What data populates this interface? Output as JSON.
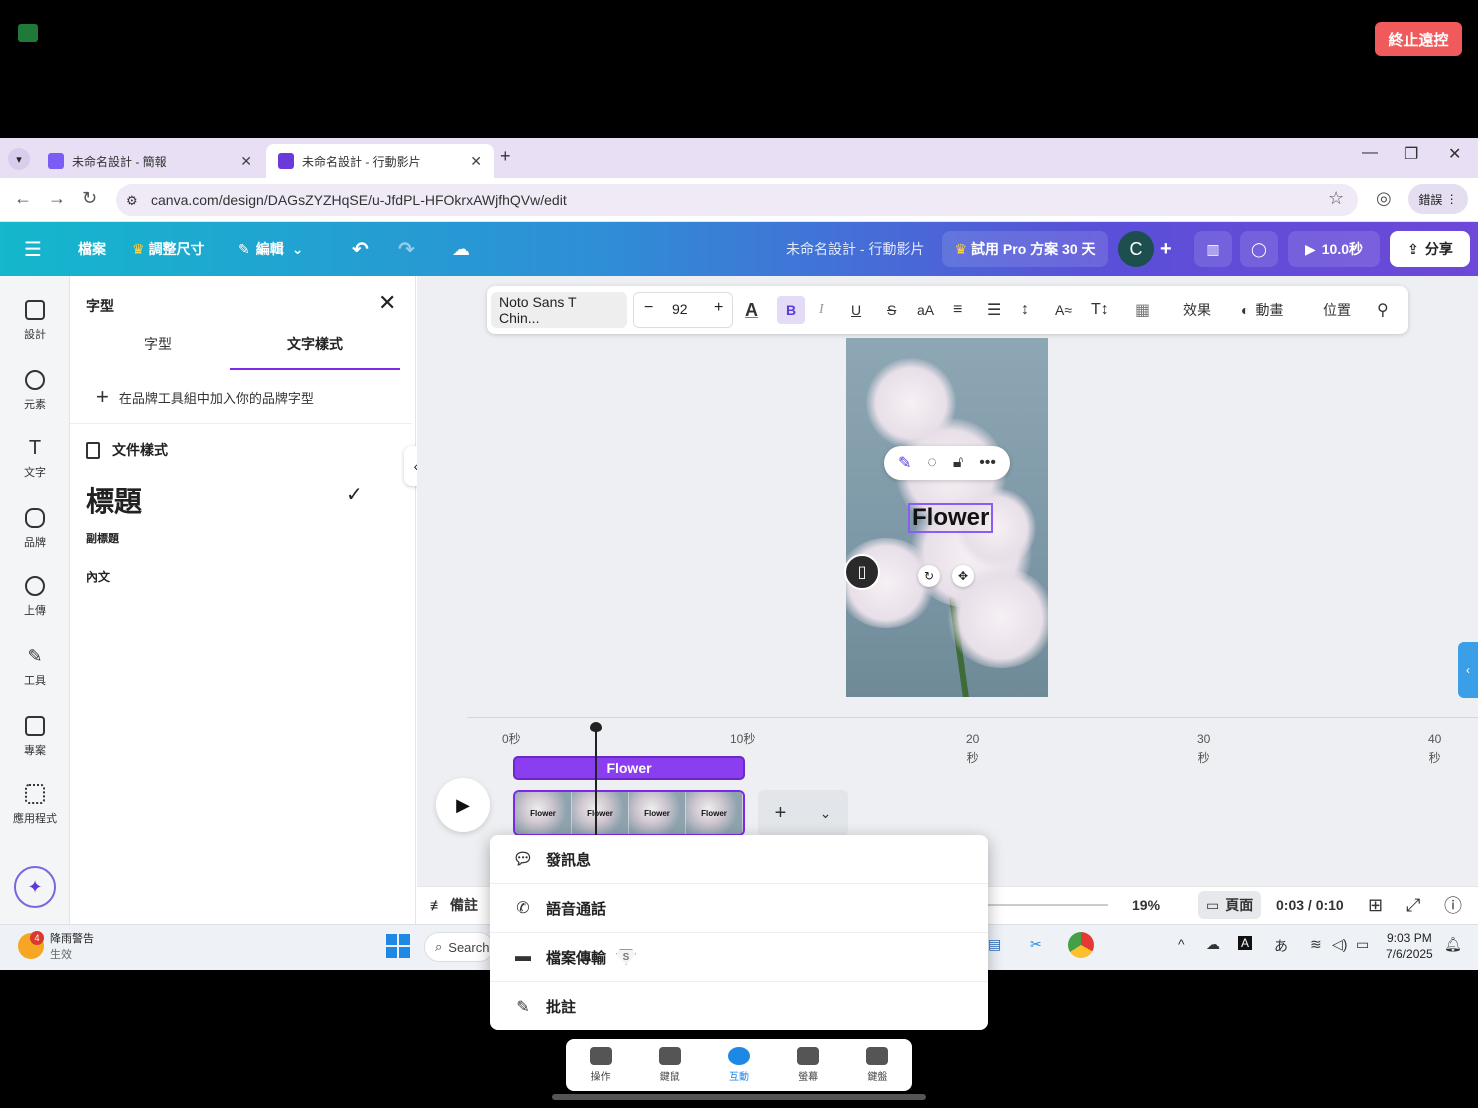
{
  "remote": {
    "stop_label": "終止遠控",
    "signal_icon": "signal-bars-icon",
    "popup_menu": [
      {
        "label": "發訊息",
        "icon": "chat-bubble-icon"
      },
      {
        "label": "語音通話",
        "icon": "phone-icon"
      },
      {
        "label": "檔案傳輸",
        "icon": "folder-icon",
        "badge": "S"
      },
      {
        "label": "批註",
        "icon": "pen-icon"
      }
    ],
    "dock": [
      {
        "label": "操作",
        "icon": "layers-icon",
        "active": false
      },
      {
        "label": "鍵鼠",
        "icon": "keyboard-mouse-icon",
        "active": false
      },
      {
        "label": "互動",
        "icon": "chat-icon",
        "active": true
      },
      {
        "label": "螢幕",
        "icon": "monitor-icon",
        "active": false
      },
      {
        "label": "鍵盤",
        "icon": "keyboard-icon",
        "active": false
      }
    ]
  },
  "browser": {
    "tabs": [
      {
        "title": "未命名設計 - 簡報",
        "active": false
      },
      {
        "title": "未命名設計 - 行動影片",
        "active": true
      }
    ],
    "url": "canva.com/design/DAGsZYZHqSE/u-JfdPL-HFOkrxAWjfhQVw/edit",
    "profile_label": "錯誤"
  },
  "canva": {
    "top": {
      "file": "檔案",
      "resize": "調整尺寸",
      "edit": "編輯",
      "doc_title": "未命名設計 - 行動影片",
      "trial": "試用 Pro 方案 30 天",
      "avatar": "C",
      "play_duration": "10.0秒",
      "share": "分享"
    },
    "rail": [
      {
        "label": "設計",
        "icon": "design-icon"
      },
      {
        "label": "元素",
        "icon": "elements-icon"
      },
      {
        "label": "文字",
        "icon": "text-icon"
      },
      {
        "label": "品牌",
        "icon": "brand-icon"
      },
      {
        "label": "上傳",
        "icon": "upload-icon"
      },
      {
        "label": "工具",
        "icon": "draw-icon"
      },
      {
        "label": "專案",
        "icon": "folder-icon"
      },
      {
        "label": "應用程式",
        "icon": "apps-icon"
      }
    ],
    "panel": {
      "title": "字型",
      "tab_font": "字型",
      "tab_text_style": "文字樣式",
      "brand_add": "在品牌工具組中加入你的品牌字型",
      "doc_styles": "文件樣式",
      "heading": "標題",
      "subheading": "副標題",
      "body": "內文"
    },
    "toolbar": {
      "font": "Noto Sans T Chin...",
      "size": "92",
      "effects": "效果",
      "animate": "動畫",
      "position": "位置"
    },
    "canvas": {
      "text": "Flower"
    },
    "timeline": {
      "ticks": [
        "0秒",
        "10秒",
        "20\n秒",
        "30\n秒",
        "40\n秒"
      ],
      "text_track": "Flower",
      "thumb_label": "Flower"
    },
    "status": {
      "notes": "備註",
      "zoom": "19%",
      "page_view": "頁面",
      "time": "0:03 / 0:10"
    }
  },
  "taskbar": {
    "weather_title": "降雨警告",
    "weather_sub": "生效",
    "weather_badge": "4",
    "search": "Search",
    "time": "9:03 PM",
    "date": "7/6/2025"
  }
}
